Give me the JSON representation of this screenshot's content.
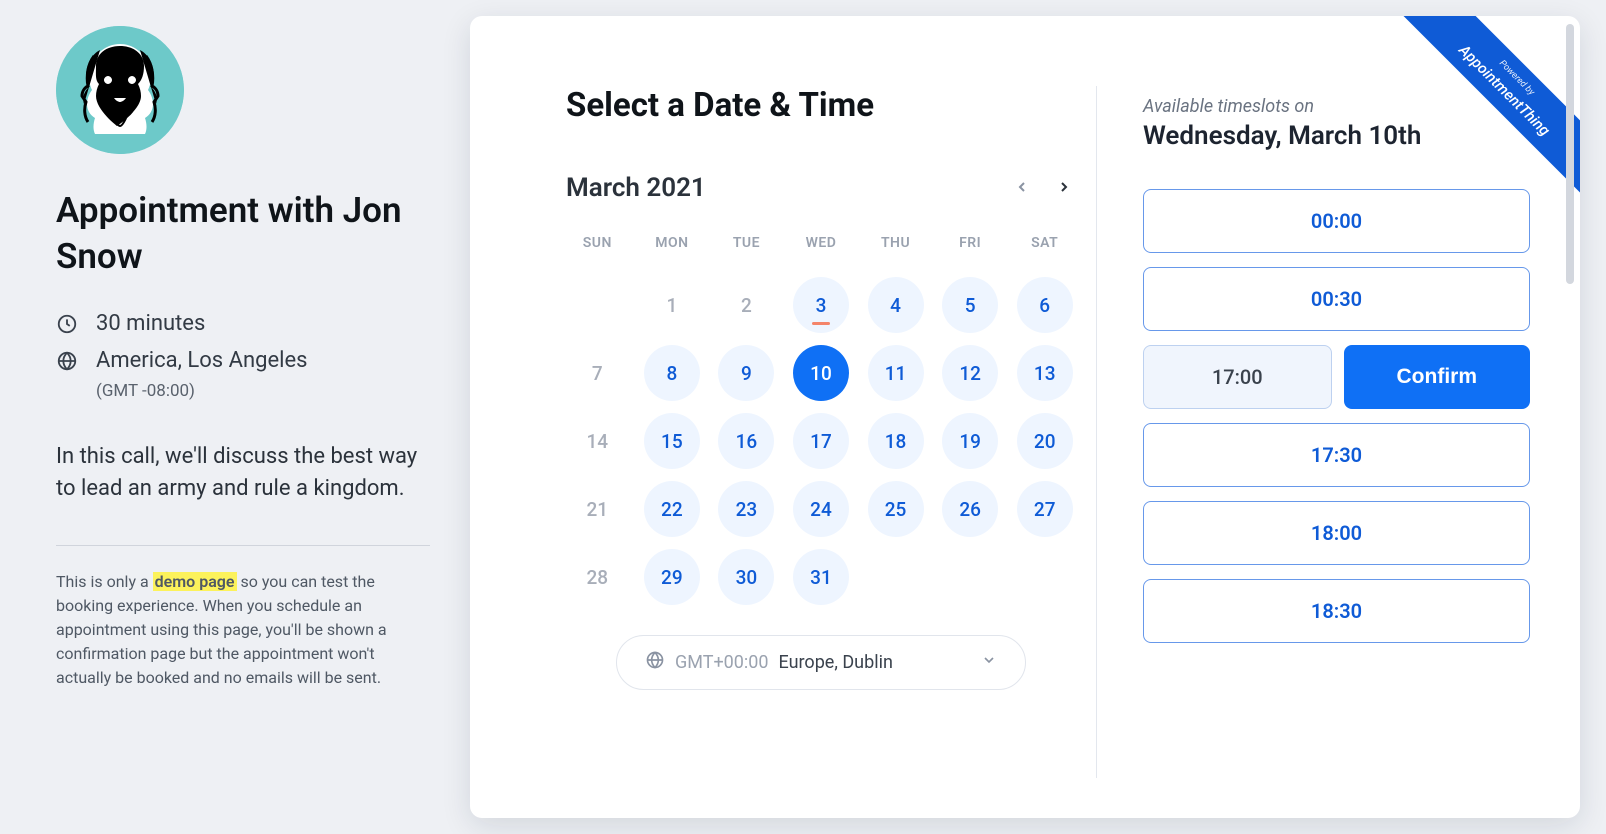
{
  "left": {
    "title": "Appointment with Jon Snow",
    "duration": "30 minutes",
    "timezone_name": "America, Los Angeles",
    "timezone_offset": "(GMT -08:00)",
    "description": "In this call, we'll discuss the best way to lead an army and rule a kingdom.",
    "demo_note_prefix": "This is only a ",
    "demo_note_highlight": "demo page",
    "demo_note_suffix": " so you can test the booking experience. When you schedule an appointment using this page, you'll be shown a confirmation page but the appointment won't actually be booked and no emails will be sent."
  },
  "ribbon": {
    "small": "Powered by",
    "brand": "AppointmentThing"
  },
  "card": {
    "title": "Select a Date & Time",
    "month_label": "March 2021",
    "dow": [
      "SUN",
      "MON",
      "TUE",
      "WED",
      "THU",
      "FRI",
      "SAT"
    ],
    "days": [
      {
        "n": "",
        "state": "empty"
      },
      {
        "n": "1",
        "state": "past"
      },
      {
        "n": "2",
        "state": "past"
      },
      {
        "n": "3",
        "state": "avail",
        "today": true
      },
      {
        "n": "4",
        "state": "avail"
      },
      {
        "n": "5",
        "state": "avail"
      },
      {
        "n": "6",
        "state": "avail"
      },
      {
        "n": "7",
        "state": "past"
      },
      {
        "n": "8",
        "state": "avail"
      },
      {
        "n": "9",
        "state": "avail"
      },
      {
        "n": "10",
        "state": "selected"
      },
      {
        "n": "11",
        "state": "avail"
      },
      {
        "n": "12",
        "state": "avail"
      },
      {
        "n": "13",
        "state": "avail"
      },
      {
        "n": "14",
        "state": "past"
      },
      {
        "n": "15",
        "state": "avail"
      },
      {
        "n": "16",
        "state": "avail"
      },
      {
        "n": "17",
        "state": "avail"
      },
      {
        "n": "18",
        "state": "avail"
      },
      {
        "n": "19",
        "state": "avail"
      },
      {
        "n": "20",
        "state": "avail"
      },
      {
        "n": "21",
        "state": "past"
      },
      {
        "n": "22",
        "state": "avail"
      },
      {
        "n": "23",
        "state": "avail"
      },
      {
        "n": "24",
        "state": "avail"
      },
      {
        "n": "25",
        "state": "avail"
      },
      {
        "n": "26",
        "state": "avail"
      },
      {
        "n": "27",
        "state": "avail"
      },
      {
        "n": "28",
        "state": "past"
      },
      {
        "n": "29",
        "state": "avail"
      },
      {
        "n": "30",
        "state": "avail"
      },
      {
        "n": "31",
        "state": "avail"
      }
    ],
    "tz_gmt": "GMT+00:00",
    "tz_name": "Europe, Dublin"
  },
  "slots": {
    "header_small": "Available timeslots on",
    "header_date": "Wednesday, March 10th",
    "items": [
      {
        "time": "00:00",
        "picked": false
      },
      {
        "time": "00:30",
        "picked": false
      },
      {
        "time": "17:00",
        "picked": true
      },
      {
        "time": "17:30",
        "picked": false
      },
      {
        "time": "18:00",
        "picked": false
      },
      {
        "time": "18:30",
        "picked": false
      }
    ],
    "confirm_label": "Confirm"
  }
}
